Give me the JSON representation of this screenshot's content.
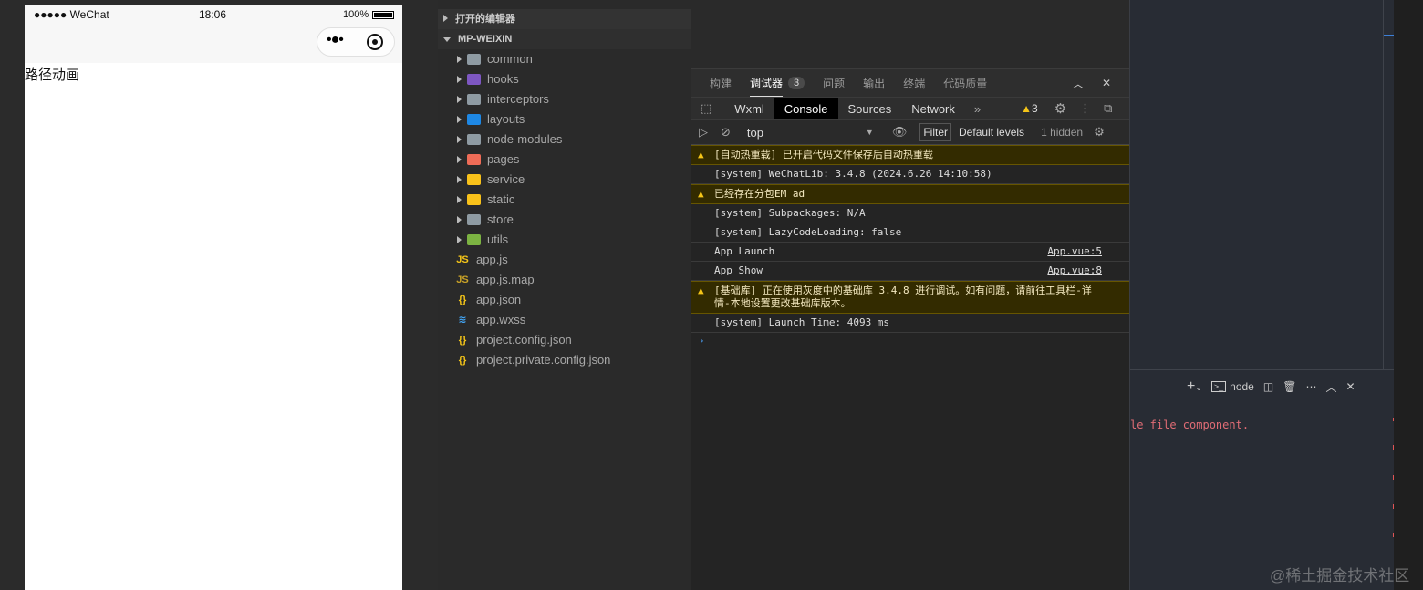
{
  "phone": {
    "carrier": "●●●●● WeChat",
    "time": "18:06",
    "battery": "100%",
    "page_text": "路径动画"
  },
  "explorer": {
    "open_editors": "打开的编辑器",
    "project": "MP-WEIXIN",
    "folders": [
      {
        "name": "common",
        "color": "#8f9ba3"
      },
      {
        "name": "hooks",
        "color": "#7e57c2"
      },
      {
        "name": "interceptors",
        "color": "#8f9ba3"
      },
      {
        "name": "layouts",
        "color": "#1e88e5"
      },
      {
        "name": "node-modules",
        "color": "#8f9ba3"
      },
      {
        "name": "pages",
        "color": "#ef6c57"
      },
      {
        "name": "service",
        "color": "#f9c21a"
      },
      {
        "name": "static",
        "color": "#f9c21a"
      },
      {
        "name": "store",
        "color": "#8f9ba3"
      },
      {
        "name": "utils",
        "color": "#7cb342"
      }
    ],
    "files": [
      {
        "name": "app.js",
        "icon": "JS",
        "color": "#f5c518"
      },
      {
        "name": "app.js.map",
        "icon": "JS",
        "color": "#c9a227"
      },
      {
        "name": "app.json",
        "icon": "{}",
        "color": "#f5c518"
      },
      {
        "name": "app.wxss",
        "icon": "≋",
        "color": "#42a5f5"
      },
      {
        "name": "project.config.json",
        "icon": "{}",
        "color": "#f5c518"
      },
      {
        "name": "project.private.config.json",
        "icon": "{}",
        "color": "#f5c518"
      }
    ]
  },
  "devtools": {
    "tabs": [
      "构建",
      "调试器",
      "问题",
      "输出",
      "终端",
      "代码质量"
    ],
    "active_tab": "调试器",
    "badge": "3",
    "panels": [
      "Wxml",
      "Console",
      "Sources",
      "Network"
    ],
    "active_panel": "Console",
    "warn_count": "3",
    "context": "top",
    "filter": "Filter",
    "levels": "Default levels",
    "hidden": "1 hidden",
    "logs": [
      {
        "type": "warn",
        "text": "[自动热重载] 已开启代码文件保存后自动热重载"
      },
      {
        "type": "log",
        "text": "[system] WeChatLib: 3.4.8 (2024.6.26 14:10:58)"
      },
      {
        "type": "warn",
        "text": "已经存在分包EM ad"
      },
      {
        "type": "log",
        "text": "[system] Subpackages: N/A"
      },
      {
        "type": "log",
        "text": "[system] LazyCodeLoading: false"
      },
      {
        "type": "log",
        "text": "App Launch",
        "source": "App.vue:5"
      },
      {
        "type": "log",
        "text": "App Show",
        "source": "App.vue:8"
      },
      {
        "type": "warn",
        "text": "[基础库] 正在使用灰度中的基础库 3.4.8 进行调试。如有问题，请前往工具栏-详情-本地设置更改基础库版本。"
      },
      {
        "type": "log",
        "text": "[system] Launch Time: 4093 ms"
      }
    ]
  },
  "terminal": {
    "shell": "node",
    "error_text": "le file component."
  },
  "watermark": "@稀土掘金技术社区"
}
